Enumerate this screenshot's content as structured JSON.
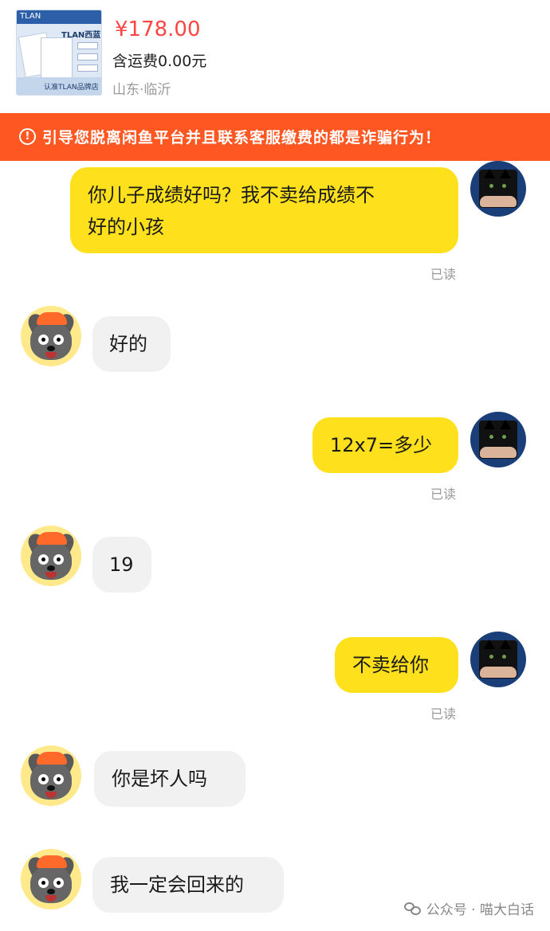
{
  "product": {
    "thumbnail": {
      "brand_left": "TLAN",
      "brand_right": "TLAN西蓝",
      "store_label": "认准TLAN品牌店"
    },
    "price": "¥178.00",
    "shipping": "含运费0.00元",
    "location": "山东·临沂"
  },
  "warning": {
    "icon": "exclamation-circle-icon",
    "text": "引导您脱离闲鱼平台并且联系客服缴费的都是诈骗行为！",
    "background": "#ff5722"
  },
  "chat": {
    "messages": [
      {
        "side": "outgoing",
        "text_line1": "你儿子成绩好吗？我不卖给成绩不",
        "text_line2": "好的小孩",
        "status": "已读"
      },
      {
        "side": "incoming",
        "text": "好的"
      },
      {
        "side": "outgoing",
        "text": "12x7=多少",
        "status": "已读"
      },
      {
        "side": "incoming",
        "text": "19"
      },
      {
        "side": "outgoing",
        "text": "不卖给你",
        "status": "已读"
      },
      {
        "side": "incoming",
        "text": "你是坏人吗"
      },
      {
        "side": "incoming",
        "text": "我一定会回来的"
      }
    ],
    "outgoing_bubble_color": "#ffe01c",
    "incoming_bubble_color": "#f1f1f1",
    "seller_avatar": "black-cat-avatar",
    "buyer_avatar": "grey-wolf-avatar"
  },
  "watermark": {
    "icon": "wechat-icon",
    "text": "公众号 · 喵大白话"
  }
}
